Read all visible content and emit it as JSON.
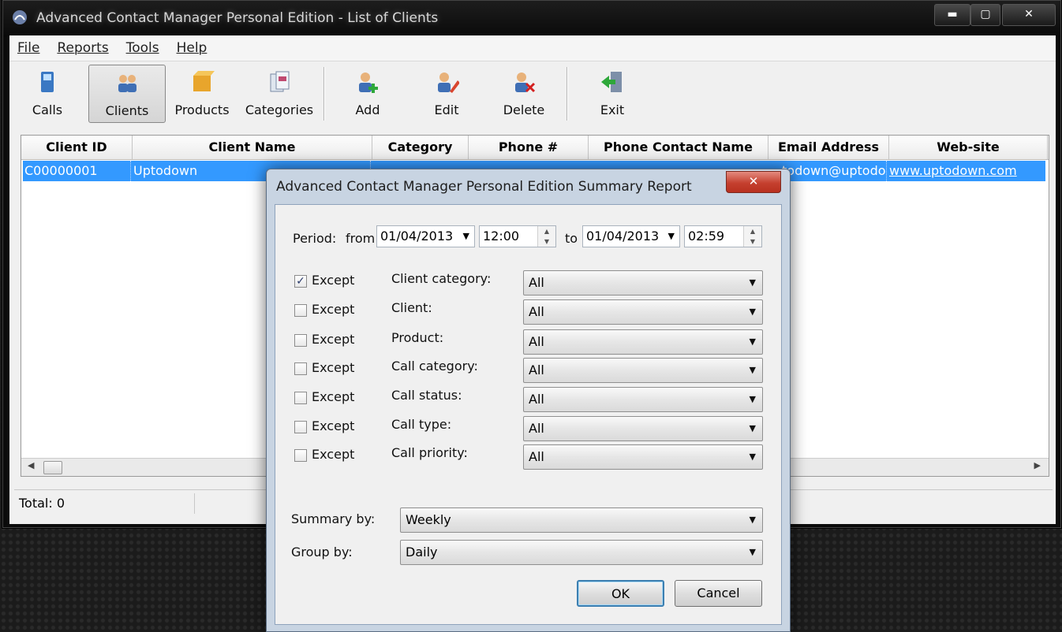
{
  "window": {
    "title": "Advanced Contact Manager Personal Edition - List of Clients",
    "controls": {
      "min": "▬",
      "max": "▢",
      "close": "✕"
    }
  },
  "menu": [
    "File",
    "Reports",
    "Tools",
    "Help"
  ],
  "toolbar": {
    "calls": "Calls",
    "clients": "Clients",
    "products": "Products",
    "categories": "Categories",
    "add": "Add",
    "edit": "Edit",
    "delete": "Delete",
    "exit": "Exit"
  },
  "grid": {
    "columns": [
      "Client ID",
      "Client Name",
      "Category",
      "Phone #",
      "Phone Contact Name",
      "Email Address",
      "Web-site"
    ],
    "rows": [
      {
        "client_id": "C00000001",
        "client_name": "Uptodown",
        "email": "todown@uptodow",
        "website": "www.uptodown.com"
      }
    ]
  },
  "status": {
    "total": "Total: 0"
  },
  "dialog": {
    "title": "Advanced Contact Manager  Personal Edition Summary Report",
    "close": "✕",
    "period_label": "Period:",
    "from_label": "from",
    "from_date": "01/04/2013",
    "from_time": "12:00",
    "to_label": "to",
    "to_date": "01/04/2013",
    "to_time": "02:59",
    "except_label": "Except",
    "filters": [
      {
        "label": "Client category:",
        "value": "All",
        "checked": true
      },
      {
        "label": "Client:",
        "value": "All",
        "checked": false
      },
      {
        "label": "Product:",
        "value": "All",
        "checked": false
      },
      {
        "label": "Call category:",
        "value": "All",
        "checked": false
      },
      {
        "label": "Call status:",
        "value": "All",
        "checked": false
      },
      {
        "label": "Call type:",
        "value": "All",
        "checked": false
      },
      {
        "label": "Call priority:",
        "value": "All",
        "checked": false
      }
    ],
    "summary_by_label": "Summary by:",
    "summary_by_value": "Weekly",
    "group_by_label": "Group by:",
    "group_by_value": "Daily",
    "ok": "OK",
    "cancel": "Cancel"
  }
}
